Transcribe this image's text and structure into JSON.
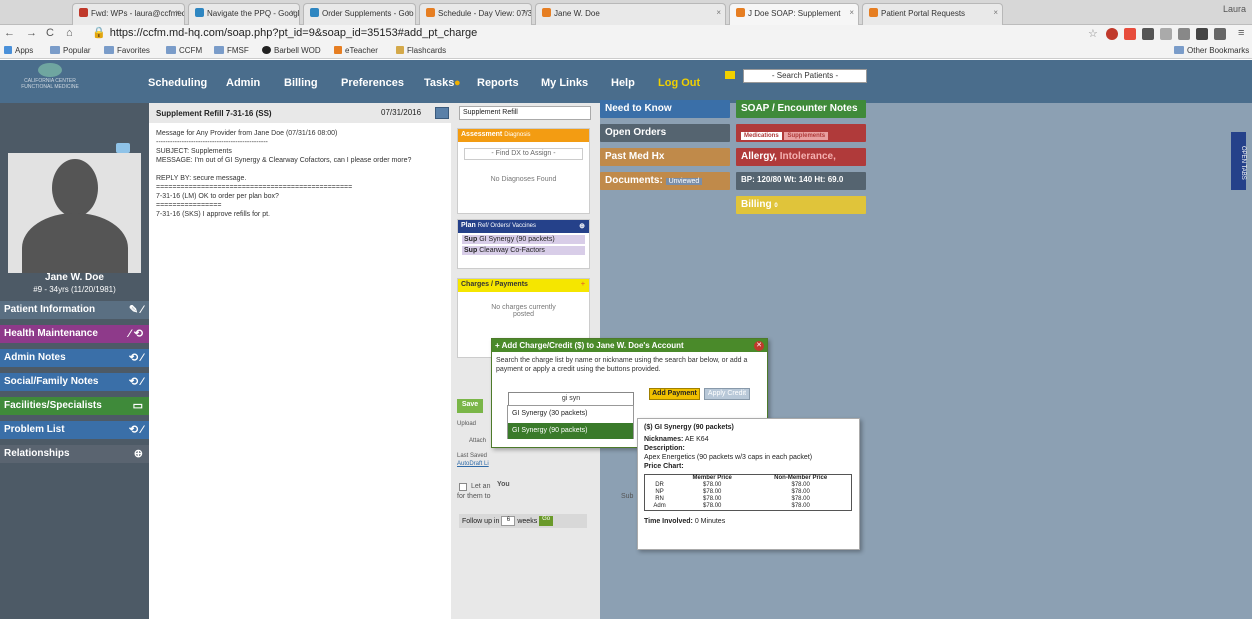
{
  "browser": {
    "tabs": [
      {
        "label": "Fwd: WPs - laura@ccfmed",
        "color": "#c0392b"
      },
      {
        "label": "Navigate the PPQ - Googl",
        "color": "#2e86c1"
      },
      {
        "label": "Order Supplements - Goo",
        "color": "#2e86c1"
      },
      {
        "label": "Schedule - Day View: 07/3",
        "color": "#e67e22"
      },
      {
        "label": "Jane W. Doe",
        "color": "#e67e22"
      },
      {
        "label": "J Doe SOAP: Supplement",
        "color": "#e67e22"
      },
      {
        "label": "Patient Portal Requests",
        "color": "#e67e22"
      }
    ],
    "user": "Laura",
    "url": "https://ccfm.md-hq.com/soap.php?pt_id=9&soap_id=35153#add_pt_charge",
    "bookmarks": [
      "Apps",
      "Popular",
      "Favorites",
      "CCFM",
      "FMSF",
      "Barbell WOD",
      "eTeacher",
      "Flashcards"
    ],
    "other_bookmarks": "Other Bookmarks"
  },
  "nav": {
    "items": [
      "Scheduling",
      "Admin",
      "Billing",
      "Preferences",
      "Tasks",
      "Reports",
      "My Links",
      "Help"
    ],
    "logout": "Log Out",
    "search_placeholder": "- Search Patients -"
  },
  "logo": {
    "line1": "CALIFORNIA CENTER",
    "line2": "FUNCTIONAL MEDICINE"
  },
  "patient": {
    "name": "Jane W. Doe",
    "info": "#9 - 34yrs (11/20/1981)"
  },
  "sidebar": {
    "items": [
      {
        "label": "Patient Information",
        "color": "#5a6f82"
      },
      {
        "label": "Health Maintenance",
        "color": "#8e3a8a"
      },
      {
        "label": "Admin Notes",
        "color": "#3a6fa8"
      },
      {
        "label": "Social/Family Notes",
        "color": "#3a6fa8"
      },
      {
        "label": "Facilities/Specialists",
        "color": "#3f8a3a"
      },
      {
        "label": "Problem List",
        "color": "#3a6fa8"
      },
      {
        "label": "Relationships",
        "color": "#5a6470"
      }
    ]
  },
  "note": {
    "title": "Supplement Refill 7-31-16  (SS)",
    "date": "07/31/2016",
    "type": "Supplement Refill",
    "body": "Message for Any Provider from Jane Doe (07/31/16 08:00)\n------------------------------------------------\nSUBJECT: Supplements\nMESSAGE: I'm out of GI Synergy & Clearway Cofactors, can I please order more?\n\nREPLY BY: secure message.\n================================================\n7-31-16 (LM) OK to order per plan box?\n================\n7-31-16 (SKS) I approve refills for pt."
  },
  "assessment": {
    "header": "Assessment",
    "sub": "Diagnosis",
    "find_dx": "- Find DX to Assign -",
    "empty": "No Diagnoses Found"
  },
  "plan": {
    "header": "Plan",
    "sub": "Ref/ Orders/ Vaccines",
    "items": [
      "GI Synergy (90 packets)",
      "Clearway Co-Factors"
    ],
    "prefix": "Sup"
  },
  "charges": {
    "header": "Charges / Payments",
    "empty_line1": "No charges currently",
    "empty_line2": "posted"
  },
  "midcol": {
    "save": "Save",
    "upload": "Upload",
    "attach": "Attach",
    "last_saved": "Last Saved",
    "autodraft": "AutoDraft Li",
    "let_label": "Let an",
    "for_them": "for them to",
    "you": "You",
    "sub": "Sub",
    "followup_label": "Follow up in",
    "followup_value": "6",
    "followup_unit": "weeks",
    "go": "Go"
  },
  "right": {
    "need_to_know": "Need to Know",
    "open_orders": "Open Orders",
    "past_med_hx": "Past Med Hx",
    "documents": "Documents:",
    "unviewed": "Unviewed",
    "soap_notes": "SOAP / Encounter Notes",
    "medications": "Medications",
    "supplements": "Supplements",
    "allergy": "Allergy,",
    "intolerance": "Intolerance,",
    "vitals": "BP: 120/80   Wt: 140   Ht: 69.0",
    "billing": "Billing",
    "billing_sub": "0",
    "open_tabs": "OPEN TABS"
  },
  "modal": {
    "title": "+ Add Charge/Credit ($) to Jane W. Doe's Account",
    "message": "Search the charge list by name or nickname using the search bar below, or add a payment or apply a credit using the buttons provided.",
    "search_value": "gi syn",
    "add_payment": "Add Payment",
    "apply_credit": "Apply Credit",
    "results": [
      "GI Synergy (30 packets)",
      "GI Synergy (90 packets)"
    ]
  },
  "detail": {
    "title": "($) GI Synergy (90 packets)",
    "nicknames_label": "Nicknames:",
    "nicknames": "AE K64",
    "description_label": "Description:",
    "description": "Apex Energetics (90 packets w/3 caps in each packet)",
    "price_chart_label": "Price Chart:",
    "columns": [
      "",
      "Member Price",
      "Non-Member Price"
    ],
    "rows": [
      [
        "DR",
        "$78.00",
        "$78.00"
      ],
      [
        "NP",
        "$78.00",
        "$78.00"
      ],
      [
        "RN",
        "$78.00",
        "$78.00"
      ],
      [
        "Adm",
        "$78.00",
        "$78.00"
      ]
    ],
    "time_label": "Time Involved:",
    "time_value": "0 Minutes"
  }
}
